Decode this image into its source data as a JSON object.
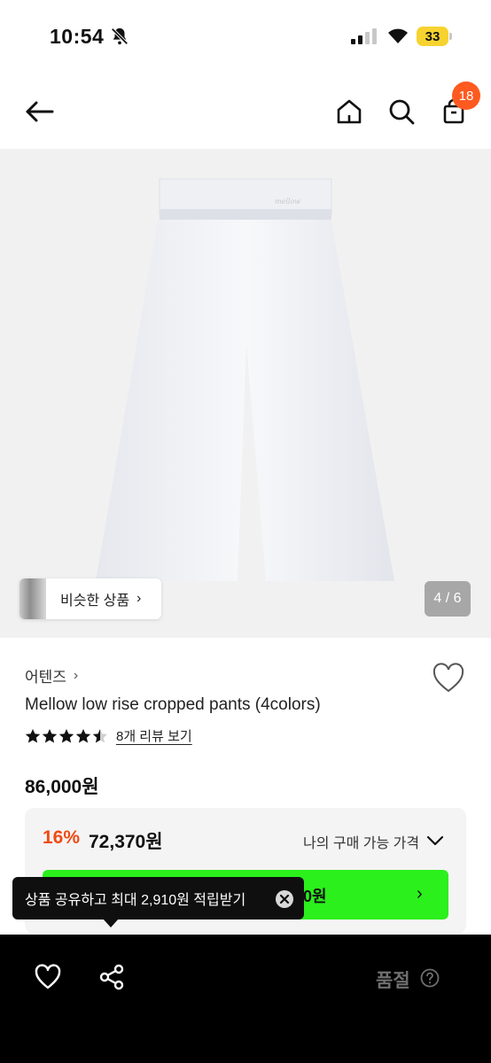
{
  "status_bar": {
    "time": "10:54",
    "battery": "33",
    "icons": [
      "bell-slash-icon",
      "cellular-signal-icon",
      "wifi-icon",
      "battery-icon"
    ]
  },
  "top_nav": {
    "icons": [
      "back-arrow-icon",
      "home-icon",
      "search-icon",
      "shopping-bag-icon"
    ],
    "cart_count": "18"
  },
  "gallery": {
    "similar_label": "비슷한 상품",
    "page_indicator": "4 / 6"
  },
  "product": {
    "brand": "어텐즈",
    "title": "Mellow low rise cropped pants (4colors)",
    "rating": 4.5,
    "review_link": "8개 리뷰 보기",
    "price": "86,000원"
  },
  "discount": {
    "rate": "16%",
    "price": "72,370원",
    "my_price_label": "나의 구매 가능 가격",
    "cta_text": "0원"
  },
  "tooltip": {
    "text": "상품 공유하고 최대 2,910원 적립받기"
  },
  "bottom_bar": {
    "icons": [
      "heart-icon",
      "share-icon",
      "question-circle-icon"
    ],
    "status": "품절"
  },
  "colors": {
    "accent_orange": "#ff5a1f",
    "discount_red": "#f04a13",
    "cta_green": "#2bf01c",
    "bottom_bar": "#000000"
  }
}
